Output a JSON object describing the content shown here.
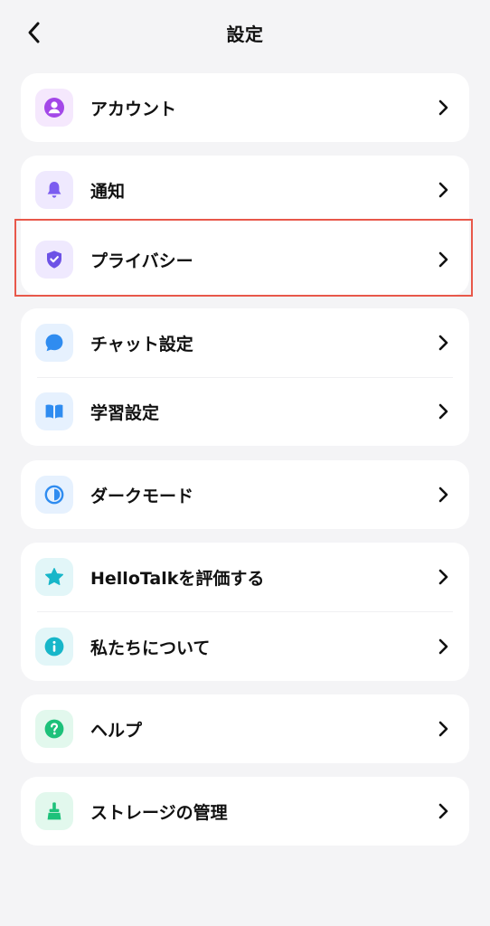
{
  "header": {
    "title": "設定",
    "back_icon": "chevron-left-icon"
  },
  "sections": [
    {
      "items": [
        {
          "label": "アカウント",
          "icon": "account-icon",
          "icon_color": "#a347e8",
          "icon_bg": "#f5e8fd"
        }
      ]
    },
    {
      "items": [
        {
          "label": "通知",
          "icon": "bell-icon",
          "icon_color": "#7b5cf0",
          "icon_bg": "#efe9fe"
        },
        {
          "label": "プライバシー",
          "icon": "shield-icon",
          "icon_color": "#6d52e6",
          "icon_bg": "#efe9fe",
          "highlighted": true
        }
      ]
    },
    {
      "items": [
        {
          "label": "チャット設定",
          "icon": "chat-bubble-icon",
          "icon_color": "#2f8cf0",
          "icon_bg": "#e6f1fe"
        },
        {
          "label": "学習設定",
          "icon": "book-icon",
          "icon_color": "#2f8cf0",
          "icon_bg": "#e6f1fe"
        }
      ]
    },
    {
      "items": [
        {
          "label": "ダークモード",
          "icon": "half-circle-icon",
          "icon_color": "#2f8cf0",
          "icon_bg": "#e6f1fe"
        }
      ]
    },
    {
      "items": [
        {
          "label": "HelloTalkを評価する",
          "icon": "star-icon",
          "icon_color": "#17b6c9",
          "icon_bg": "#e2f6f8"
        },
        {
          "label": "私たちについて",
          "icon": "info-icon",
          "icon_color": "#17b6c9",
          "icon_bg": "#e2f6f8"
        }
      ]
    },
    {
      "items": [
        {
          "label": "ヘルプ",
          "icon": "help-icon",
          "icon_color": "#1dc17a",
          "icon_bg": "#e2f8ed"
        }
      ]
    },
    {
      "items": [
        {
          "label": "ストレージの管理",
          "icon": "broom-icon",
          "icon_color": "#1dc17a",
          "icon_bg": "#e2f8ed"
        }
      ]
    }
  ],
  "colors": {
    "background": "#f4f4f6",
    "card": "#ffffff",
    "highlight_border": "#e8584a"
  }
}
